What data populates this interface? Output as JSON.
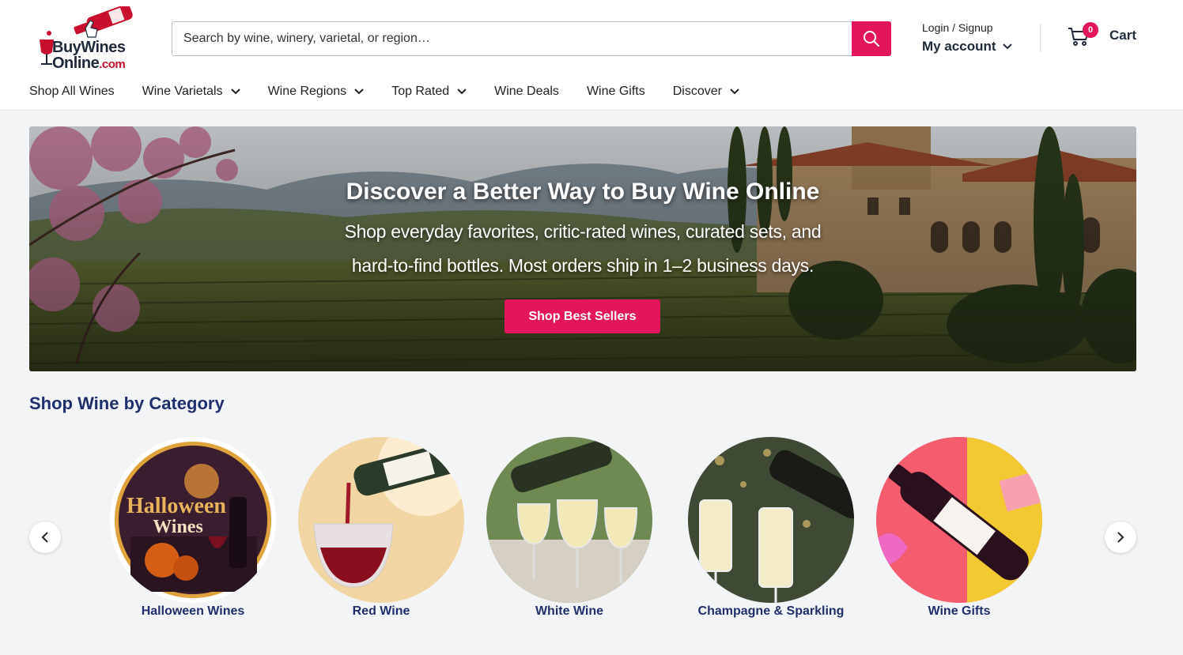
{
  "header": {
    "logo_line1": "BuyWines",
    "logo_line2": "Online",
    "logo_suffix": ".com",
    "search_placeholder": "Search by wine, winery, varietal, or region…",
    "login_label": "Login / Signup",
    "account_label": "My account",
    "cart_count": "0",
    "cart_label": "Cart"
  },
  "nav": {
    "items": [
      {
        "label": "Shop All Wines"
      },
      {
        "label": "Wine Varietals"
      },
      {
        "label": "Wine Regions"
      },
      {
        "label": "Top Rated"
      },
      {
        "label": "Wine Deals"
      },
      {
        "label": "Wine Gifts"
      },
      {
        "label": "Discover"
      }
    ]
  },
  "hero": {
    "title": "Discover a Better Way to Buy Wine Online",
    "subtitle": "Shop everyday favorites, critic-rated wines, curated sets, and hard-to-find bottles. Most orders ship in 1–2 business days.",
    "button": "Shop Best Sellers"
  },
  "categories": {
    "title": "Shop Wine by Category",
    "items": [
      {
        "label": "Halloween Wines",
        "image_text_1": "Halloween",
        "image_text_2": "Wines"
      },
      {
        "label": "Red Wine"
      },
      {
        "label": "White Wine"
      },
      {
        "label": "Champagne & Sparkling"
      },
      {
        "label": "Wine Gifts"
      }
    ]
  },
  "colors": {
    "accent": "#e3165b",
    "navy": "#1e2f6b"
  }
}
